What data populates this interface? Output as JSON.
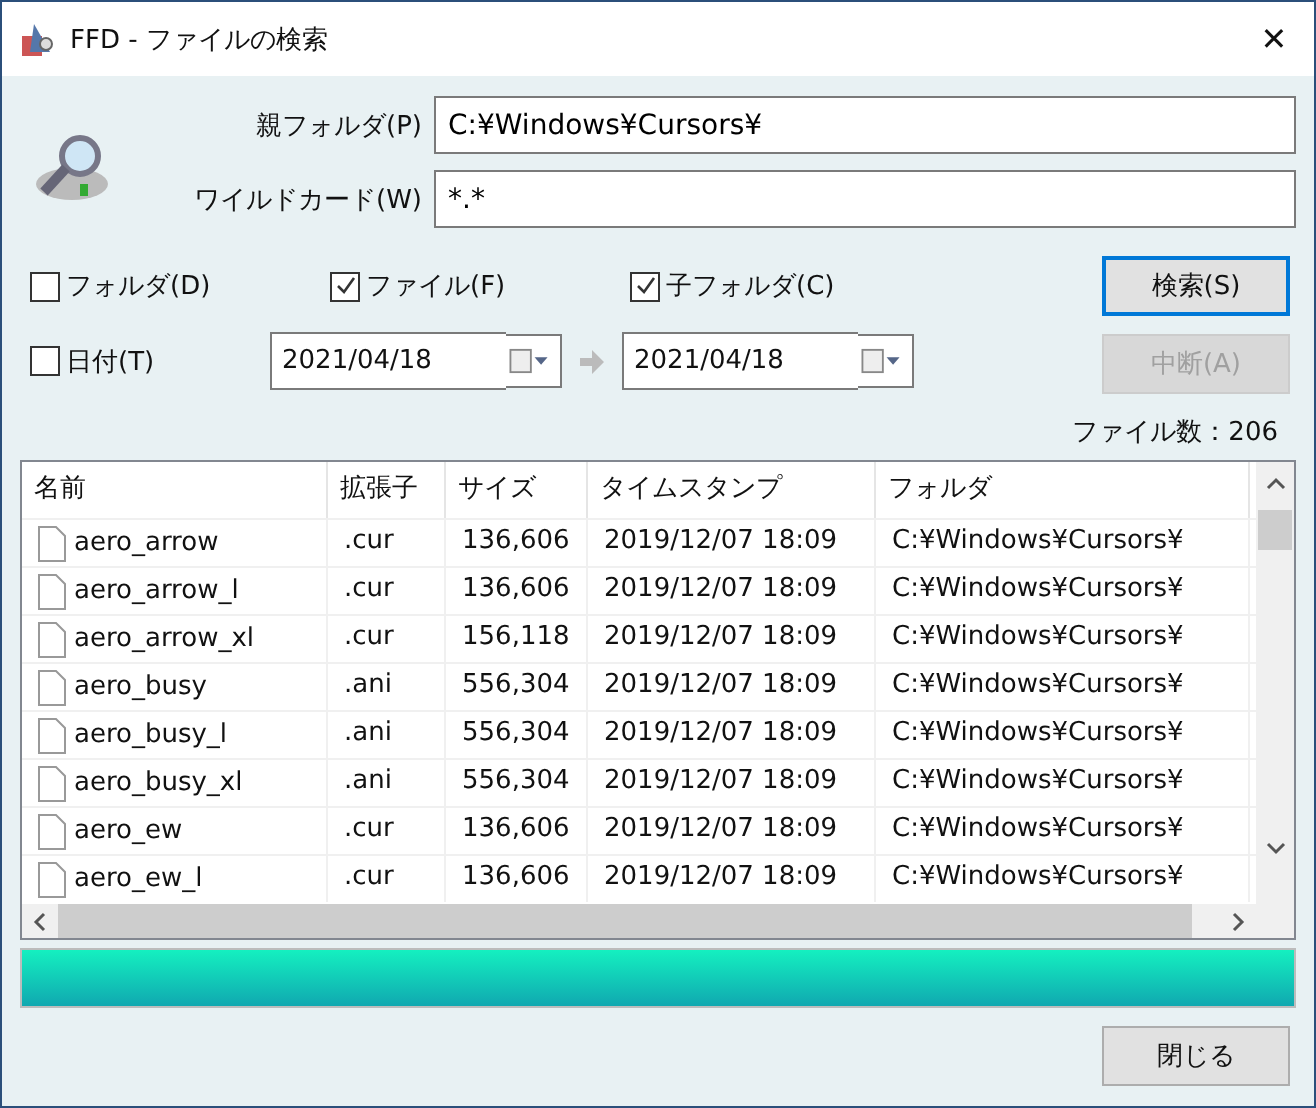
{
  "window": {
    "title": "FFD - ファイルの検索",
    "close": "✕"
  },
  "fields": [
    {
      "label": "親フォルダ(P)",
      "value": "C:¥Windows¥Cursors¥"
    },
    {
      "label": "ワイルドカード(W)",
      "value": "*.*"
    }
  ],
  "checkboxes": [
    {
      "label": "フォルダ(D)",
      "checked": false
    },
    {
      "label": "ファイル(F)",
      "checked": true
    },
    {
      "label": "子フォルダ(C)",
      "checked": true
    }
  ],
  "date_filter": {
    "label": "日付(T)",
    "checked": false,
    "from": "2021/04/18",
    "to": "2021/04/18"
  },
  "buttons": [
    {
      "label": "検索(S)",
      "disabled": false,
      "default": true
    },
    {
      "label": "中断(A)",
      "disabled": true,
      "default": false
    }
  ],
  "file_count": "ファイル数：206",
  "table": {
    "columns": [
      "名前",
      "拡張子",
      "サイズ",
      "タイムスタンプ",
      "フォルダ"
    ],
    "rows": [
      [
        "aero_arrow",
        ".cur",
        "136,606",
        "2019/12/07 18:09",
        "C:¥Windows¥Cursors¥"
      ],
      [
        "aero_arrow_l",
        ".cur",
        "136,606",
        "2019/12/07 18:09",
        "C:¥Windows¥Cursors¥"
      ],
      [
        "aero_arrow_xl",
        ".cur",
        "156,118",
        "2019/12/07 18:09",
        "C:¥Windows¥Cursors¥"
      ],
      [
        "aero_busy",
        ".ani",
        "556,304",
        "2019/12/07 18:09",
        "C:¥Windows¥Cursors¥"
      ],
      [
        "aero_busy_l",
        ".ani",
        "556,304",
        "2019/12/07 18:09",
        "C:¥Windows¥Cursors¥"
      ],
      [
        "aero_busy_xl",
        ".ani",
        "556,304",
        "2019/12/07 18:09",
        "C:¥Windows¥Cursors¥"
      ],
      [
        "aero_ew",
        ".cur",
        "136,606",
        "2019/12/07 18:09",
        "C:¥Windows¥Cursors¥"
      ],
      [
        "aero_ew_l",
        ".cur",
        "136,606",
        "2019/12/07 18:09",
        "C:¥Windows¥Cursors¥"
      ]
    ]
  },
  "progress": {
    "level": 1
  },
  "close_button": "閉じる"
}
